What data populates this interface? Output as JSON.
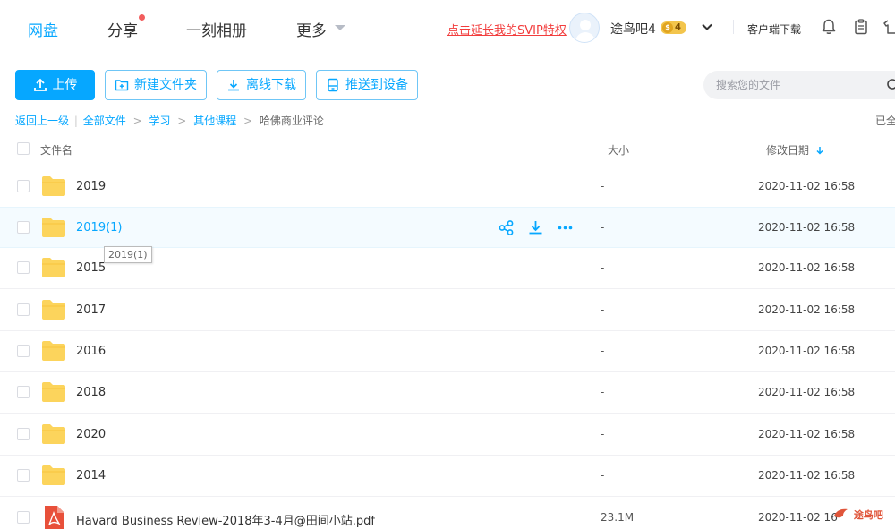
{
  "nav": {
    "tabs": [
      {
        "label": "网盘",
        "active": true
      },
      {
        "label": "分享",
        "has_dot": true
      },
      {
        "label": "一刻相册"
      },
      {
        "label": "更多"
      }
    ],
    "svip_link": "点击延长我的SVIP特权",
    "username": "途鸟吧4",
    "vip_level": "4",
    "coin_symbol": "$",
    "client_download": "客户端下载",
    "icons": [
      "bell-icon",
      "clipboard-icon",
      "shirt-icon"
    ]
  },
  "toolbar": {
    "upload": "上传",
    "new_folder": "新建文件夹",
    "offline_download": "离线下载",
    "push_to_device": "推送到设备",
    "search_placeholder": "搜索您的文件"
  },
  "breadcrumb": {
    "back": "返回上一级",
    "items": [
      "全部文件",
      "学习",
      "其他课程"
    ],
    "current": "哈佛商业评论",
    "loaded_text": "已全"
  },
  "table": {
    "headers": {
      "name": "文件名",
      "size": "大小",
      "modified": "修改日期"
    },
    "rows": [
      {
        "name": "2019",
        "size": "-",
        "date": "2020-11-02 16:58",
        "type": "folder"
      },
      {
        "name": "2019(1)",
        "size": "-",
        "date": "2020-11-02 16:58",
        "type": "folder",
        "hover": true
      },
      {
        "name": "2015",
        "size": "-",
        "date": "2020-11-02 16:58",
        "type": "folder"
      },
      {
        "name": "2017",
        "size": "-",
        "date": "2020-11-02 16:58",
        "type": "folder"
      },
      {
        "name": "2016",
        "size": "-",
        "date": "2020-11-02 16:58",
        "type": "folder"
      },
      {
        "name": "2018",
        "size": "-",
        "date": "2020-11-02 16:58",
        "type": "folder"
      },
      {
        "name": "2020",
        "size": "-",
        "date": "2020-11-02 16:58",
        "type": "folder"
      },
      {
        "name": "2014",
        "size": "-",
        "date": "2020-11-02 16:58",
        "type": "folder"
      },
      {
        "name": "Havard Business Review-2018年3-4月@田间小站.pdf",
        "size": "23.1M",
        "date": "2020-11-02 16",
        "type": "pdf"
      }
    ],
    "tooltip": "2019(1)"
  },
  "watermark": "途鸟吧",
  "colors": {
    "accent": "#06a7ff",
    "svip_link": "#f23d3d",
    "folder": "#fcd45c",
    "pdf": "#e8503a"
  }
}
